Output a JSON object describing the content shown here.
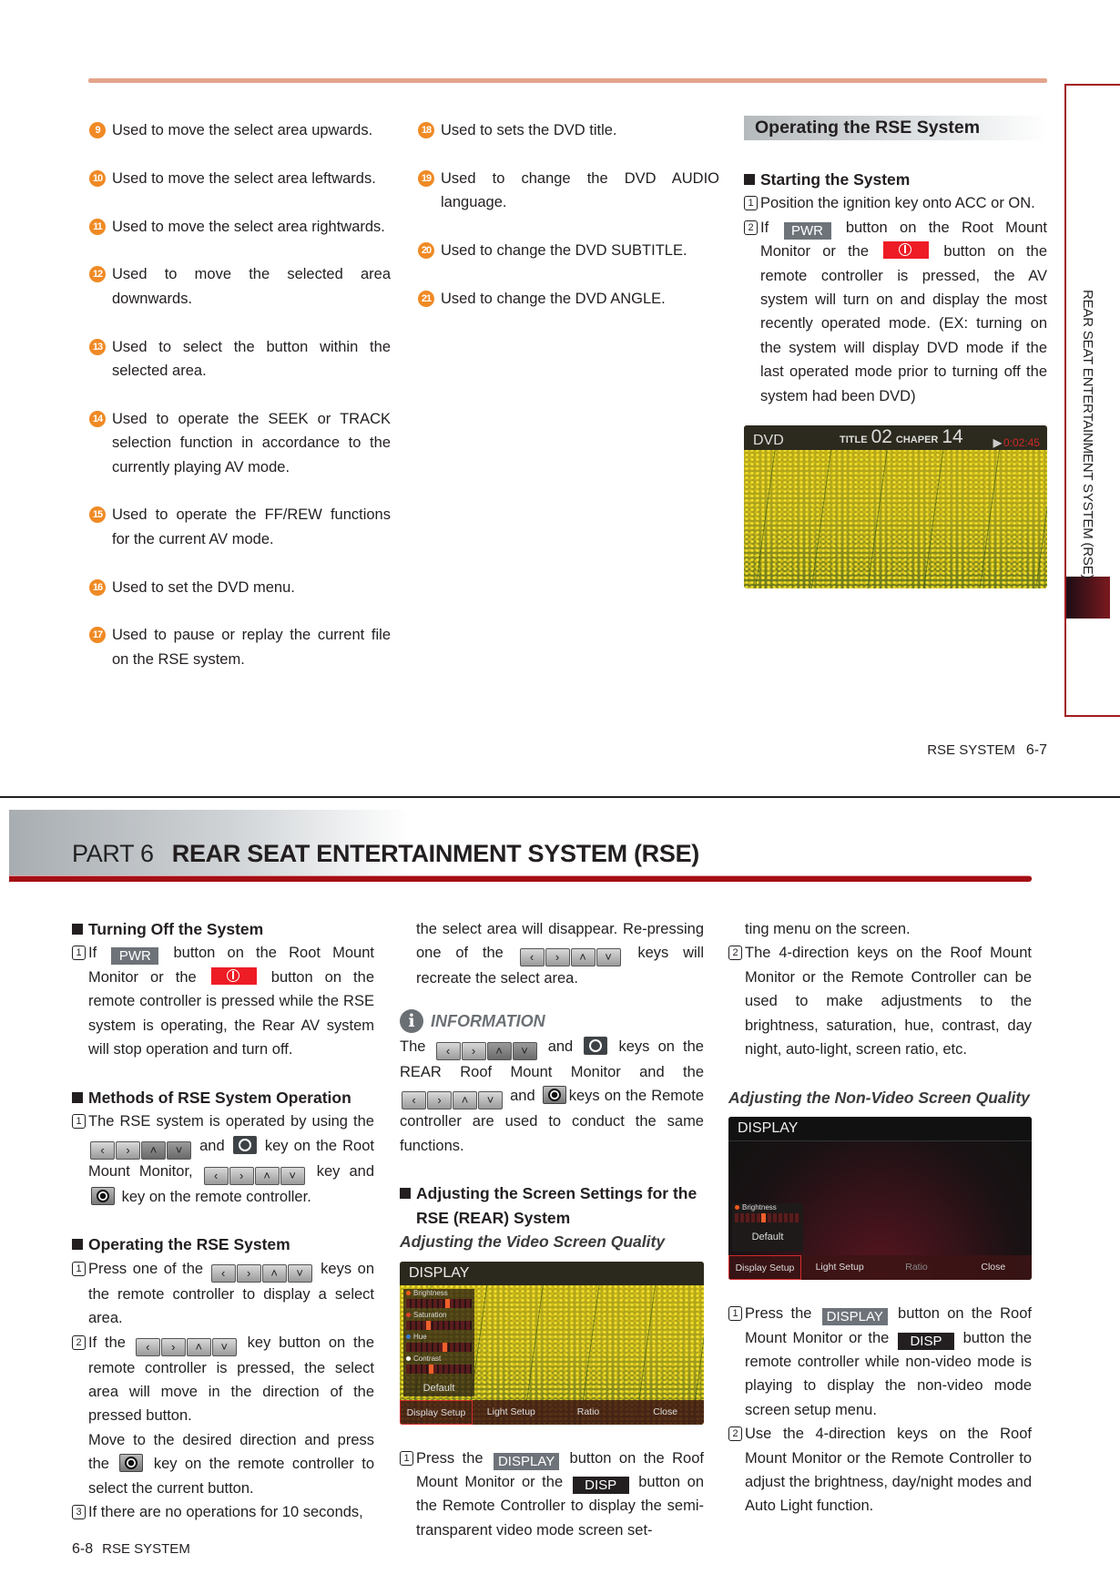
{
  "top_page": {
    "left_items": [
      {
        "num": "9",
        "text": "Used to move the select area upwards."
      },
      {
        "num": "10",
        "text": "Used to move the select area leftwards."
      },
      {
        "num": "11",
        "text": "Used to move the select area rightwards."
      },
      {
        "num": "12",
        "text": "Used to move the selected area downwards."
      },
      {
        "num": "13",
        "text": "Used to select the button within the selected area."
      },
      {
        "num": "14",
        "text": "Used to operate the SEEK or TRACK selection function in accordance to the currently playing AV mode."
      },
      {
        "num": "15",
        "text": "Used to operate the FF/REW functions for the current AV mode."
      },
      {
        "num": "16",
        "text": "Used to set the DVD menu."
      },
      {
        "num": "17",
        "text": "Used to pause or replay the current file on the RSE system."
      }
    ],
    "mid_items": [
      {
        "num": "18",
        "text": "Used to sets the DVD title."
      },
      {
        "num": "19",
        "text": "Used to change the DVD AUDIO language."
      },
      {
        "num": "20",
        "text": "Used to change the DVD SUBTITLE."
      },
      {
        "num": "21",
        "text": "Used to change the DVD ANGLE."
      }
    ],
    "right": {
      "section_title": "Operating the RSE System",
      "heading": "Starting the System",
      "steps": [
        {
          "num": "1",
          "segs": [
            "Position the ignition key onto ACC or ON."
          ]
        },
        {
          "num": "2",
          "segs": [
            "If ",
            {
              "key": "pwr",
              "label": "PWR"
            },
            " button on the Root Mount Monitor or the ",
            {
              "key": "power"
            },
            " button on the remote controller is pressed, the AV system will turn on and display the most recently operated mode. (EX: turning on the system will display DVD  mode if the last operated mode prior to turning off the system had been DVD)"
          ]
        }
      ],
      "dvd_screen": {
        "mode": "DVD",
        "title_label": "TITLE",
        "title": "02",
        "chapter_label": "CHAPER",
        "chapter": "14",
        "time": "0:02:45"
      }
    },
    "side_tab": "REAR SEAT ENTERTAINMENT SYSTEM (RSE)",
    "footer": {
      "label": "RSE SYSTEM",
      "page": "6-7"
    }
  },
  "bottom_page": {
    "part": "PART 6",
    "title": "REAR SEAT ENTERTAINMENT SYSTEM (RSE)",
    "columns": [
      [
        {
          "type": "heading",
          "text": "Turning Off the System"
        },
        {
          "type": "step",
          "num": "1",
          "segs": [
            "If ",
            {
              "key": "pwr",
              "label": "PWR"
            },
            " button on the Root Mount Monitor or the ",
            {
              "key": "power"
            },
            " button on the remote controller is pressed while the RSE system is operating, the Rear AV system will stop operation and turn off."
          ]
        },
        {
          "type": "heading",
          "text": "Methods of RSE System Operation"
        },
        {
          "type": "step",
          "num": "1",
          "segs": [
            "The RSE system is operated by using the ",
            {
              "key": "dir_monitor"
            },
            " and ",
            {
              "key": "enter_monitor"
            },
            " key on the Root Mount Monitor, ",
            {
              "key": "dir_remote"
            },
            " key and ",
            {
              "key": "enter_remote"
            },
            " key on the remote controller."
          ]
        },
        {
          "type": "heading",
          "text": "Operating the RSE System"
        },
        {
          "type": "step",
          "num": "1",
          "segs": [
            "Press one of the ",
            {
              "key": "dir_remote"
            },
            " keys on the remote controller to display a select area."
          ]
        },
        {
          "type": "step",
          "num": "2",
          "segs": [
            "If the ",
            {
              "key": "dir_remote"
            },
            " key button on the remote controller is pressed, the select area will move in the direction of the pressed button."
          ]
        },
        {
          "type": "cont",
          "segs": [
            "Move to the desired direction and press the ",
            {
              "key": "enter_remote"
            },
            " key on the remote controller to select the current button."
          ]
        },
        {
          "type": "step",
          "num": "3",
          "segs": [
            "If there are no operations for 10 seconds,"
          ]
        }
      ],
      [
        {
          "type": "cont",
          "segs": [
            "the select area will disappear. Re-pressing one of the ",
            {
              "key": "dir_remote"
            },
            " keys will recreate the select area."
          ]
        },
        {
          "type": "info",
          "label": "INFORMATION"
        },
        {
          "type": "para",
          "segs": [
            "The ",
            {
              "key": "dir_monitor"
            },
            " and ",
            {
              "key": "enter_monitor"
            },
            " keys on the REAR Roof Mount Monitor and the ",
            {
              "key": "dir_remote"
            },
            " and ",
            {
              "key": "enter_remote"
            },
            "keys on the Remote controller are used to conduct the same functions."
          ]
        },
        {
          "type": "heading",
          "text": "Adjusting the Screen Settings for the RSE (REAR) System"
        },
        {
          "type": "subheading",
          "text": "Adjusting the Video Screen Quality"
        },
        {
          "type": "screen",
          "variant": "video",
          "title": "DISPLAY",
          "sliders": [
            {
              "label": "Brightness",
              "level": 0.6,
              "color": "#f05a1a"
            },
            {
              "label": "Saturation",
              "level": 0.3,
              "color": "#e0402a"
            },
            {
              "label": "Hue",
              "level": 0.55,
              "color": "#3a7ad0"
            },
            {
              "label": "Contrast",
              "level": 0.35,
              "color": "#ffffff"
            }
          ],
          "default": "Default",
          "menu": [
            "Display Setup",
            "Light Setup",
            "Ratio",
            "Close"
          ]
        },
        {
          "type": "step",
          "num": "1",
          "segs": [
            "Press the ",
            {
              "key": "display",
              "label": "DISPLAY"
            },
            " button on the Roof Mount Monitor or the ",
            {
              "key": "disp",
              "label": "DISP"
            },
            " button on the Remote Controller to display the semi-transparent video mode screen set-"
          ]
        }
      ],
      [
        {
          "type": "cont",
          "segs": [
            "ting menu on the screen."
          ]
        },
        {
          "type": "step",
          "num": "2",
          "segs": [
            "The 4-direction keys on the Roof Mount Monitor or the Remote Controller can be used to make adjustments to the brightness, saturation, hue, contrast, day night, auto-light, screen ratio, etc."
          ]
        },
        {
          "type": "subheading",
          "text": "Adjusting the Non-Video Screen Quality"
        },
        {
          "type": "screen",
          "variant": "nonvideo",
          "title": "DISPLAY",
          "sliders": [
            {
              "label": "Brightness",
              "level": 0.4,
              "color": "#f05a1a"
            }
          ],
          "default": "Default",
          "menu": [
            "Display Setup",
            "Light Setup",
            "Ratio",
            "Close"
          ]
        },
        {
          "type": "step",
          "num": "1",
          "segs": [
            "Press the ",
            {
              "key": "display",
              "label": "DISPLAY"
            },
            " button on the Roof Mount Monitor or the ",
            {
              "key": "disp",
              "label": "DISP"
            },
            " button the remote controller while non-video mode is playing to display the non-video mode screen setup menu."
          ]
        },
        {
          "type": "step",
          "num": "2",
          "segs": [
            "Use the 4-direction keys on the Roof Mount Monitor or the Remote Controller to adjust the brightness, day/night modes and Auto Light function."
          ]
        }
      ]
    ],
    "footer": {
      "page": "6-8",
      "label": "RSE SYSTEM"
    }
  }
}
